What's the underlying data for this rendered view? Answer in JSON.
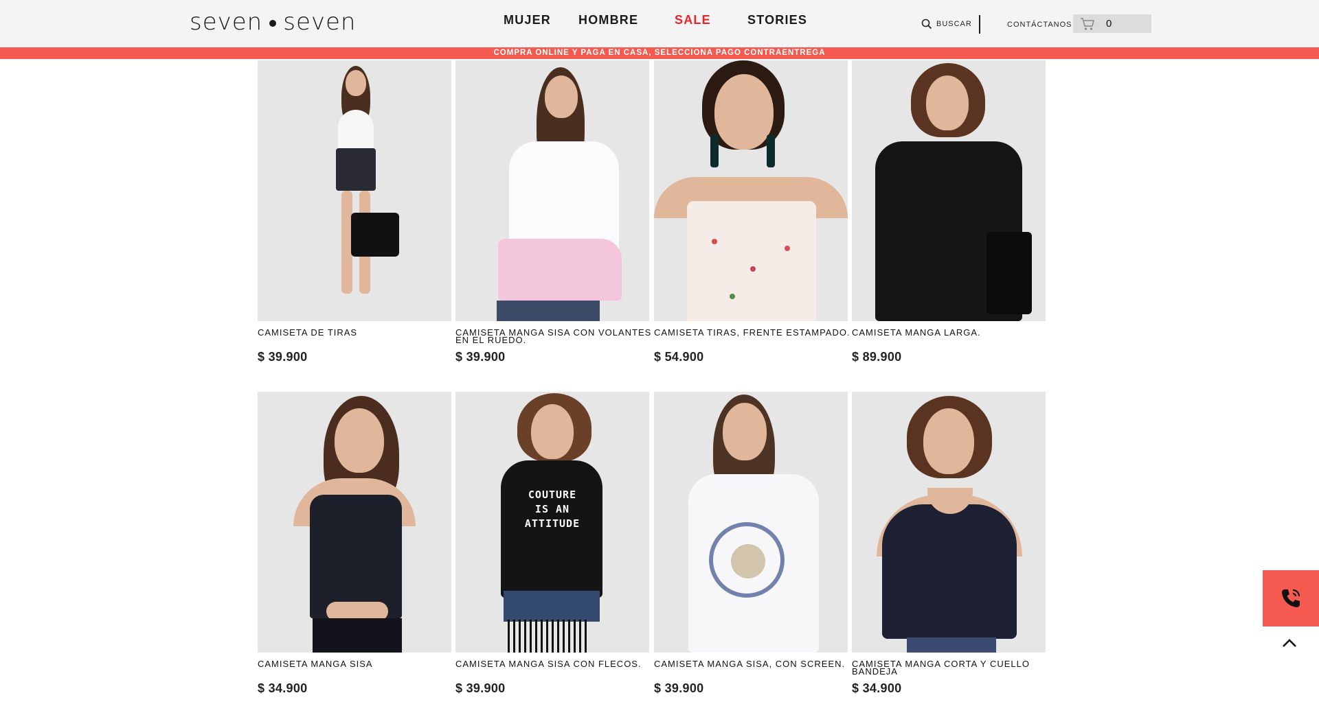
{
  "brand": {
    "left": "seven",
    "right": "seven"
  },
  "nav": {
    "women": "MUJER",
    "men": "HOMBRE",
    "sale": "SALE",
    "stories": "STORIES"
  },
  "header": {
    "search_label": "BUSCAR",
    "contact_label": "CONTÁCTANOS",
    "cart_count": "0"
  },
  "promo": {
    "text": "COMPRA ONLINE Y PAGA EN CASA, SELECCIONA PAGO CONTRAENTREGA"
  },
  "products": [
    {
      "name": "CAMISETA DE TIRAS",
      "price": "$ 39.900"
    },
    {
      "name": "CAMISETA MANGA SISA CON VOLANTES EN EL RUEDO.",
      "price": "$ 39.900"
    },
    {
      "name": "CAMISETA TIRAS, FRENTE ESTAMPADO.",
      "price": "$ 54.900"
    },
    {
      "name": "CAMISETA MANGA LARGA.",
      "price": "$ 89.900"
    },
    {
      "name": "CAMISETA MANGA SISA",
      "price": "$ 34.900"
    },
    {
      "name": "CAMISETA MANGA SISA CON FLECOS.",
      "price": "$ 39.900"
    },
    {
      "name": "CAMISETA MANGA SISA, CON SCREEN.",
      "price": "$ 39.900"
    },
    {
      "name": "CAMISETA MANGA CORTA Y CUELLO BANDEJA",
      "price": "$ 34.900"
    }
  ],
  "shirt_print": {
    "line1": "COUTURE",
    "line2": "IS AN",
    "line3": "ATTITUDE"
  },
  "icons": {
    "search": "search-icon",
    "cart": "cart-icon",
    "phone": "phone-icon",
    "scroll_top": "chevron-up-icon"
  },
  "colors": {
    "accent": "#f55a50",
    "sale": "#e8242a",
    "header_bg": "#f4f4f4",
    "cart_bg": "#dcdcdc"
  }
}
